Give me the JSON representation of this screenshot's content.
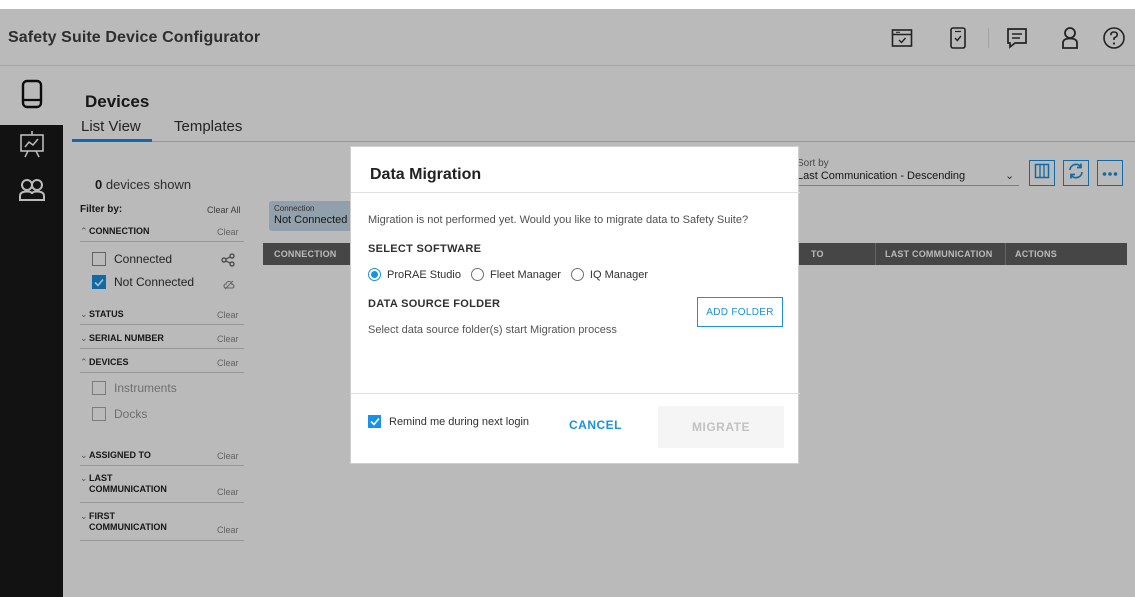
{
  "app": {
    "title": "Safety Suite Device Configurator"
  },
  "header_icons": [
    "calendar-check-icon",
    "mobile-check-icon",
    "chat-icon",
    "user-icon",
    "help-icon"
  ],
  "rail": {
    "items": [
      "device-icon",
      "dashboard-icon",
      "users-icon"
    ],
    "active": "device-icon"
  },
  "page": {
    "title": "Devices",
    "tabs": [
      {
        "label": "List View",
        "active": true
      },
      {
        "label": "Templates",
        "active": false
      }
    ],
    "devices_count": "0",
    "devices_shown_suffix": "devices shown"
  },
  "filters": {
    "heading": "Filter by:",
    "clear_all": "Clear All",
    "clear": "Clear",
    "connection": {
      "label": "CONNECTION",
      "options": [
        {
          "label": "Connected",
          "checked": false
        },
        {
          "label": "Not Connected",
          "checked": true
        }
      ]
    },
    "status": "STATUS",
    "serial_number": "SERIAL NUMBER",
    "devices": {
      "label": "DEVICES",
      "options": [
        {
          "label": "Instruments",
          "checked": false
        },
        {
          "label": "Docks",
          "checked": false
        }
      ]
    },
    "assigned_to": "ASSIGNED TO",
    "last_communication": [
      "LAST",
      "COMMUNICATION"
    ],
    "first_communication": [
      "FIRST",
      "COMMUNICATION"
    ]
  },
  "active_filter_chip": {
    "label": "Connection",
    "value": "Not Connected"
  },
  "table": {
    "columns": [
      "CONNECTION",
      "TO",
      "LAST COMMUNICATION",
      "ACTIONS"
    ]
  },
  "sort": {
    "label": "Sort by",
    "value": "Last Communication - Descending"
  },
  "modal": {
    "title": "Data Migration",
    "message": "Migration is not performed yet. Would you like to migrate data to Safety Suite?",
    "select_software_label": "SELECT SOFTWARE",
    "software_options": [
      {
        "label": "ProRAE Studio",
        "selected": true
      },
      {
        "label": "Fleet Manager",
        "selected": false
      },
      {
        "label": "IQ Manager",
        "selected": false
      }
    ],
    "data_source_label": "DATA SOURCE FOLDER",
    "data_source_hint": "Select data source folder(s) start Migration process",
    "add_folder_label": "ADD FOLDER",
    "remind_label": "Remind me during next login",
    "remind_checked": true,
    "cancel_label": "CANCEL",
    "migrate_label": "MIGRATE"
  },
  "colors": {
    "accent": "#1792e5",
    "rail": "#1a1a1a",
    "table_header": "#606060"
  }
}
